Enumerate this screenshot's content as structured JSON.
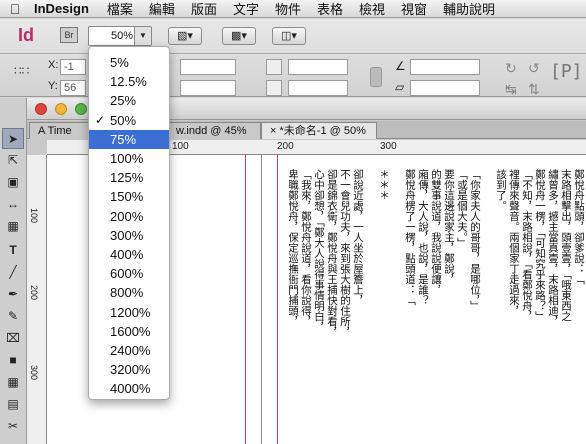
{
  "menubar": {
    "app_name": "InDesign",
    "items": [
      "檔案",
      "編輯",
      "版面",
      "文字",
      "物件",
      "表格",
      "檢視",
      "視窗",
      "輔助說明"
    ]
  },
  "control": {
    "app_logo": "Id",
    "bridge_label": "Br",
    "zoom_value": "50%",
    "x_label": "X:",
    "y_label": "Y:",
    "x_value": "-1",
    "y_value": "56",
    "ref_text": "[P]"
  },
  "zoom_menu": {
    "options": [
      "5%",
      "12.5%",
      "25%",
      "50%",
      "75%",
      "100%",
      "125%",
      "150%",
      "200%",
      "300%",
      "400%",
      "600%",
      "800%",
      "1200%",
      "1600%",
      "2400%",
      "3200%",
      "4000%"
    ],
    "checked": "50%",
    "highlighted": "75%",
    "check_mark": "✓"
  },
  "document": {
    "tabs": [
      "A Time",
      "w.indd @ 45%",
      "*未命名-1 @ 50%"
    ],
    "tab_close": "×",
    "ruler_h": [
      "100",
      "200",
      "300"
    ],
    "ruler_v": [
      "100",
      "200",
      "300"
    ],
    "text_columns": [
      "鄭悅舟點頭，卻爹說：「",
      "末路相擊出，頭壹壹，「哦東西之",
      "繡曾多，撼主當真壹，末路相迪，",
      "鄭悅舟一楞，「可知究乎來路？」",
      "「不知，末路相說，「看鄭悅舟，",
      "裡傳來聲音。兩個家丁走過來，",
      "該到了。",
      "",
      "「你家夫人的哥哥，是哪位，」",
      "「或是個大夫。」",
      "要你這邊說家主，鄭說，",
      "的雙事說道，我說說便讓，",
      "廂傳，大人說，也說，是誰？",
      "鄭悅舟楞了一楞，點頭道：「",
      "",
      "＊＊＊",
      "",
      "卻說近處，一人坐於屋簷上，",
      "不一會兒功夫，來到張大樹的住所，",
      "卻是錦衣衛，鄭悅舟與王捕快對看，",
      "心中卻想，「鄭大人說得事情明白，",
      "「我來，鄭悅舟說道，看你說得，",
      "卑職鄭悅舟，保定巡撫衙門捕頭，"
    ]
  },
  "colors": {
    "logo": "#ba2d6a",
    "highlight": "#3b6fd6",
    "light_red": "#e0443e",
    "light_yellow": "#f0b53a",
    "light_green": "#58b847",
    "margin_line": "#c0408a"
  }
}
